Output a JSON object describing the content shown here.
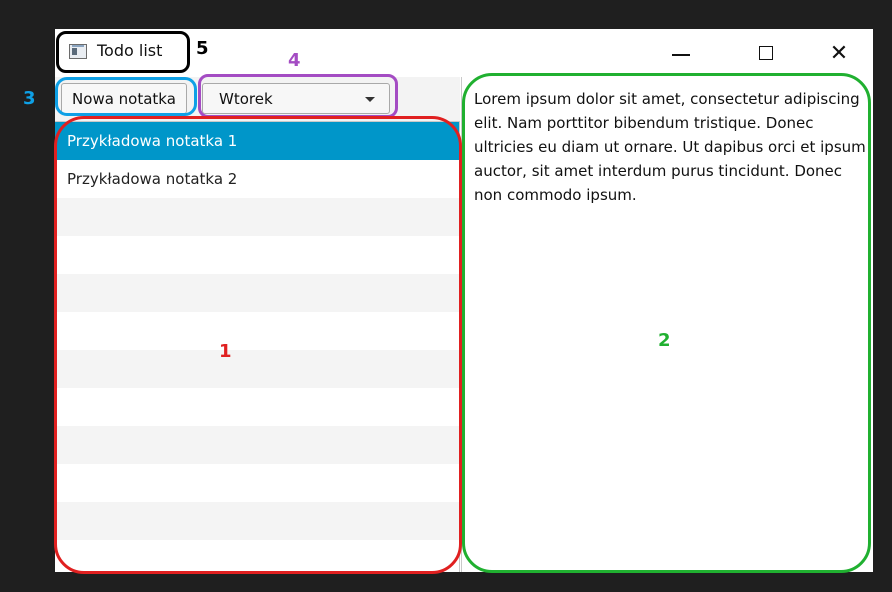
{
  "window": {
    "title": "Todo list",
    "controls": {
      "minimize": "minimize-icon",
      "maximize": "maximize-icon",
      "close": "close-icon"
    }
  },
  "toolbar": {
    "new_note_label": "Nowa notatka",
    "day_selected": "Wtorek"
  },
  "notes": [
    {
      "title": "Przykładowa notatka 1",
      "selected": true
    },
    {
      "title": "Przykładowa notatka 2",
      "selected": false
    }
  ],
  "note_content": "Lorem ipsum dolor sit amet, consectetur adipiscing elit. Nam porttitor bibendum tristique. Donec ultricies eu diam ut ornare. Ut dapibus orci et ipsum auctor, sit amet interdum purus tincidunt. Donec non commodo ipsum.",
  "annotations": {
    "list": "1",
    "content": "2",
    "new_button": "3",
    "day_select": "4",
    "title": "5"
  },
  "colors": {
    "selection": "#0096c9",
    "annotation_list": "#e02020",
    "annotation_content": "#20b030",
    "annotation_button": "#0ea0e6",
    "annotation_select": "#a44cc3",
    "annotation_title": "#000000"
  }
}
